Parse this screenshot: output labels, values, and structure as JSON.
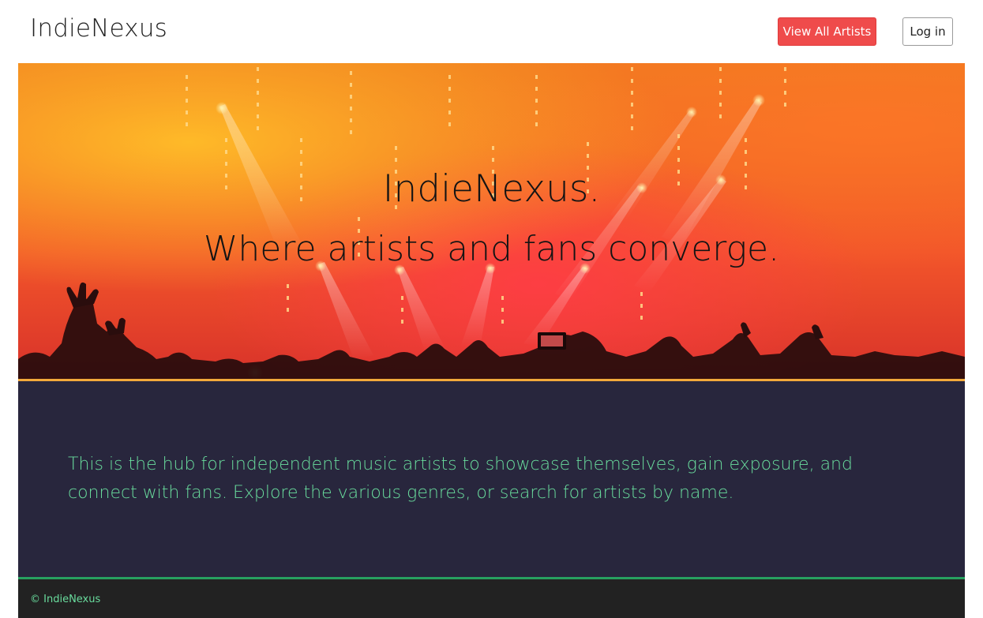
{
  "navbar": {
    "brand": "IndieNexus",
    "view_all_artists_label": "View All Artists",
    "login_label": "Log in"
  },
  "hero": {
    "title": "IndieNexus.",
    "tagline": "Where artists and fans converge.",
    "image": "concert-crowd-stage-lights"
  },
  "about": {
    "text": "This is the hub for independent music artists to showcase themselves, gain exposure, and connect with fans. Explore the various genres, or search for artists by name."
  },
  "footer": {
    "copyright": "© IndieNexus"
  },
  "colors": {
    "accent_red": "#ef4b4b",
    "about_bg": "#28263d",
    "about_text": "#69dc9d",
    "hero_border": "#f2a93b",
    "footer_border": "#27a060",
    "footer_bg": "#222222"
  }
}
